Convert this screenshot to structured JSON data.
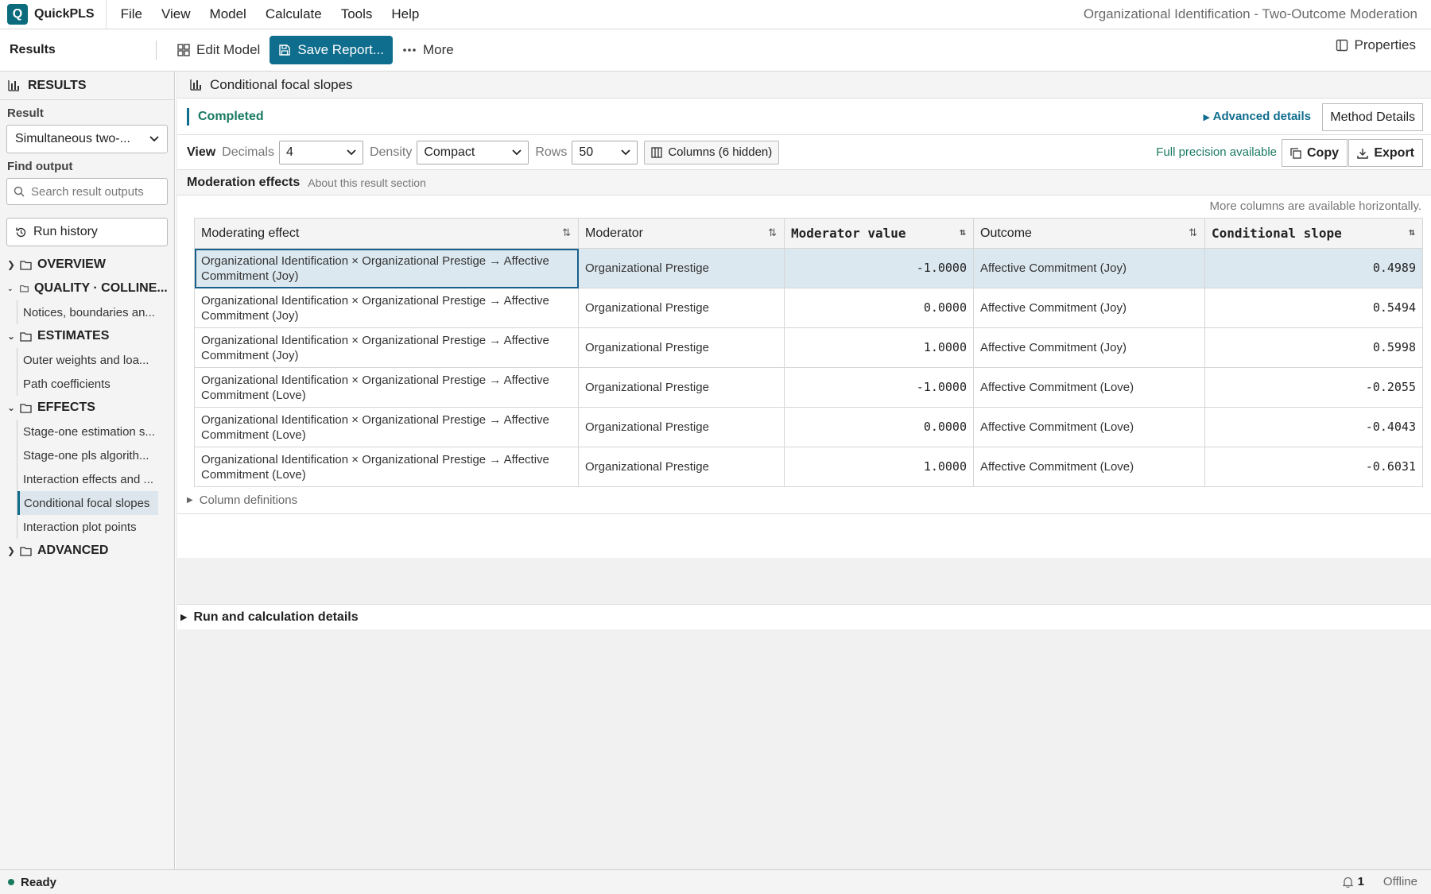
{
  "app": {
    "logo_letter": "Q",
    "name": "QuickPLS",
    "menu": [
      "File",
      "View",
      "Model",
      "Calculate",
      "Tools",
      "Help"
    ],
    "window_title": "Organizational Identification - Two-Outcome Moderation"
  },
  "toolbar": {
    "title": "Results",
    "edit_model": "Edit Model",
    "save_report": "Save Report...",
    "more": "More",
    "properties": "Properties"
  },
  "sidebar": {
    "header": "RESULTS",
    "result_label": "Result",
    "result_value": "Simultaneous two-...",
    "find_label": "Find output",
    "search_placeholder": "Search result outputs",
    "run_history": "Run history",
    "groups": {
      "overview": "OVERVIEW",
      "quality": "QUALITY · COLLINE...",
      "quality_items": [
        "Notices, boundaries an..."
      ],
      "estimates": "ESTIMATES",
      "estimates_items": [
        "Outer weights and loa...",
        "Path coefficients"
      ],
      "effects": "EFFECTS",
      "effects_items": [
        "Stage-one estimation s...",
        "Stage-one pls algorith...",
        "Interaction effects and ...",
        "Conditional focal slopes",
        "Interaction plot points"
      ],
      "advanced": "ADVANCED"
    }
  },
  "panel": {
    "title": "Conditional focal slopes",
    "status": "Completed",
    "advanced_details": "Advanced details",
    "method_details": "Method Details",
    "view_label": "View",
    "decimals_label": "Decimals",
    "decimals_value": "4",
    "density_label": "Density",
    "density_value": "Compact",
    "rows_label": "Rows",
    "rows_value": "50",
    "columns_btn": "Columns (6 hidden)",
    "full_precision": "Full precision available",
    "copy": "Copy",
    "export": "Export",
    "section_title": "Moderation effects",
    "section_about": "About this result section",
    "more_columns": "More columns are available horizontally.",
    "column_definitions": "Column definitions",
    "run_details": "Run and calculation details"
  },
  "table": {
    "headers": [
      "Moderating effect",
      "Moderator",
      "Moderator value",
      "Outcome",
      "Conditional slope"
    ],
    "rows": [
      [
        "Organizational Identification × Organizational Prestige → Affective Commitment (Joy)",
        "Organizational Prestige",
        "-1.0000",
        "Affective Commitment (Joy)",
        "0.4989"
      ],
      [
        "Organizational Identification × Organizational Prestige → Affective Commitment (Joy)",
        "Organizational Prestige",
        "0.0000",
        "Affective Commitment (Joy)",
        "0.5494"
      ],
      [
        "Organizational Identification × Organizational Prestige → Affective Commitment (Joy)",
        "Organizational Prestige",
        "1.0000",
        "Affective Commitment (Joy)",
        "0.5998"
      ],
      [
        "Organizational Identification × Organizational Prestige → Affective Commitment (Love)",
        "Organizational Prestige",
        "-1.0000",
        "Affective Commitment (Love)",
        "-0.2055"
      ],
      [
        "Organizational Identification × Organizational Prestige → Affective Commitment (Love)",
        "Organizational Prestige",
        "0.0000",
        "Affective Commitment (Love)",
        "-0.4043"
      ],
      [
        "Organizational Identification × Organizational Prestige → Affective Commitment (Love)",
        "Organizational Prestige",
        "1.0000",
        "Affective Commitment (Love)",
        "-0.6031"
      ]
    ]
  },
  "statusbar": {
    "ready": "Ready",
    "notifications": "1",
    "connection": "Offline"
  },
  "colors": {
    "accent": "#0f6d8d",
    "success": "#1a7a62",
    "selected_row": "#dce8f0"
  }
}
